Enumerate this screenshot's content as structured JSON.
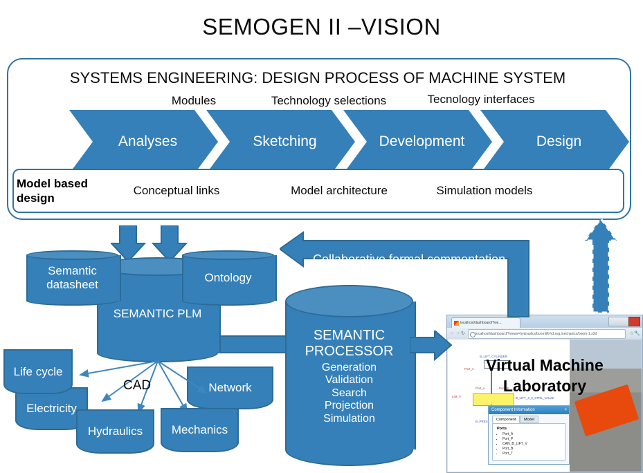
{
  "title": "SEMOGEN II –VISION",
  "systems_engineering": {
    "heading": "SYSTEMS ENGINEERING: DESIGN PROCESS OF MACHINE SYSTEM",
    "top_labels": [
      "Modules",
      "Technology selections",
      "Tecnology interfaces"
    ],
    "phases": [
      {
        "label": "Analyses"
      },
      {
        "label": "Sketching"
      },
      {
        "label": "Development"
      },
      {
        "label": "Design"
      }
    ],
    "model_based": {
      "label": "Model based design",
      "items": [
        "Conceptual links",
        "Model architecture",
        "Simulation models"
      ]
    }
  },
  "plm": {
    "semantic_datasheet": "Semantic datasheet",
    "ontology": "Ontology",
    "semantic_plm": "SEMANTIC PLM",
    "cad_label": "CAD",
    "documents": [
      {
        "label": "Life cycle"
      },
      {
        "label": "Electricity"
      },
      {
        "label": "Hydraulics"
      },
      {
        "label": "Mechanics"
      },
      {
        "label": "Network"
      }
    ]
  },
  "processor": {
    "title_line1": "SEMANTIC",
    "title_line2": "PROCESSOR",
    "functions": [
      "Generation",
      "Validation",
      "Search",
      "Projection",
      "Simulation"
    ]
  },
  "feedback_arrow": {
    "label": "Collaborative formal commentation"
  },
  "browser": {
    "tab_title": "localhost/dashboard/?vie...",
    "url": "localhost/dashboard/?views=hydraulics/boomlift-hd.svg,mechanics/boom-1.x3d",
    "overlay_line1": "Virtual Machine",
    "overlay_line2": "Laboratory",
    "schematic_labels": [
      "B_LIFT_CYLINDER",
      "Port_A",
      "Port_A",
      "Port_B",
      "B_LIFT_4_3_CTRL_VALVE",
      "B_PRESSURE_V",
      "Port_P",
      "Port_T",
      "LIM_V"
    ],
    "component_info": {
      "title": "Component Information",
      "close": "×",
      "tabs": [
        "Component",
        "Model"
      ],
      "section": "Ports",
      "ports": [
        "Port_A",
        "Port_P",
        "CAN_B_LIFT_V",
        "Port_B",
        "Port_T"
      ]
    }
  },
  "colors": {
    "blue_fill": "#3580B8",
    "blue_stroke": "#2E6B96",
    "border_blue": "#2E74A4",
    "orange": "#E8490C"
  }
}
